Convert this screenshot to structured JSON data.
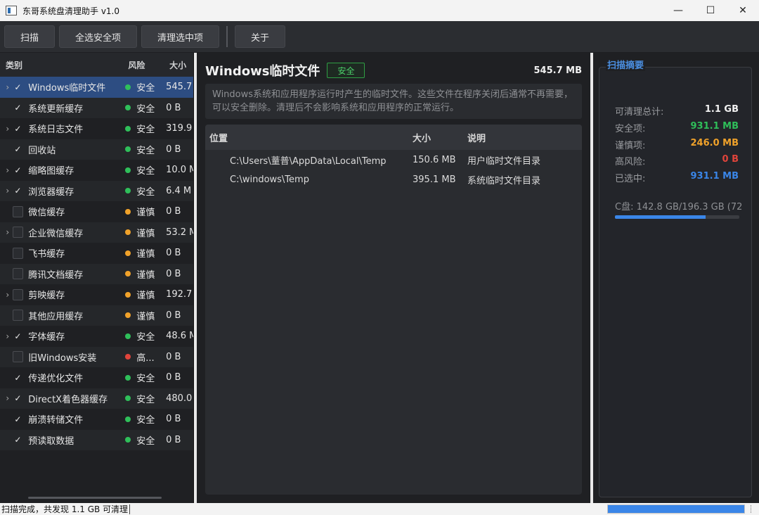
{
  "window": {
    "title": "东哥系统盘清理助手 v1.0",
    "minimize": "—",
    "maximize": "☐",
    "close": "✕"
  },
  "toolbar": {
    "scan": "扫描",
    "select_safe": "全选安全项",
    "clean_selected": "清理选中项",
    "about": "关于"
  },
  "list": {
    "headers": {
      "category": "类别",
      "risk": "风险",
      "size": "大小"
    },
    "items": [
      {
        "expand": "›",
        "checked": true,
        "name": "Windows临时文件",
        "risk": "安全",
        "size": "545.7",
        "level": "safe",
        "selected": true
      },
      {
        "expand": "",
        "checked": true,
        "name": "系统更新缓存",
        "risk": "安全",
        "size": "0 B",
        "level": "safe"
      },
      {
        "expand": "›",
        "checked": true,
        "name": "系统日志文件",
        "risk": "安全",
        "size": "319.9",
        "level": "safe"
      },
      {
        "expand": "",
        "checked": true,
        "name": "回收站",
        "risk": "安全",
        "size": "0 B",
        "level": "safe"
      },
      {
        "expand": "›",
        "checked": true,
        "name": "缩略图缓存",
        "risk": "安全",
        "size": "10.0 M",
        "level": "safe"
      },
      {
        "expand": "›",
        "checked": true,
        "name": "浏览器缓存",
        "risk": "安全",
        "size": "6.4 M",
        "level": "safe"
      },
      {
        "expand": "",
        "checked": false,
        "name": "微信缓存",
        "risk": "谨慎",
        "size": "0 B",
        "level": "caution"
      },
      {
        "expand": "›",
        "checked": false,
        "name": "企业微信缓存",
        "risk": "谨慎",
        "size": "53.2 M",
        "level": "caution"
      },
      {
        "expand": "",
        "checked": false,
        "name": "飞书缓存",
        "risk": "谨慎",
        "size": "0 B",
        "level": "caution"
      },
      {
        "expand": "",
        "checked": false,
        "name": "腾讯文档缓存",
        "risk": "谨慎",
        "size": "0 B",
        "level": "caution"
      },
      {
        "expand": "›",
        "checked": false,
        "name": "剪映缓存",
        "risk": "谨慎",
        "size": "192.7",
        "level": "caution"
      },
      {
        "expand": "",
        "checked": false,
        "name": "其他应用缓存",
        "risk": "谨慎",
        "size": "0 B",
        "level": "caution"
      },
      {
        "expand": "›",
        "checked": true,
        "name": "字体缓存",
        "risk": "安全",
        "size": "48.6 M",
        "level": "safe"
      },
      {
        "expand": "",
        "checked": false,
        "name": "旧Windows安装",
        "risk": "高...",
        "size": "0 B",
        "level": "high"
      },
      {
        "expand": "",
        "checked": true,
        "name": "传递优化文件",
        "risk": "安全",
        "size": "0 B",
        "level": "safe"
      },
      {
        "expand": "›",
        "checked": true,
        "name": "DirectX着色器缓存",
        "risk": "安全",
        "size": "480.0",
        "level": "safe"
      },
      {
        "expand": "",
        "checked": true,
        "name": "崩溃转储文件",
        "risk": "安全",
        "size": "0 B",
        "level": "safe"
      },
      {
        "expand": "",
        "checked": true,
        "name": "预读取数据",
        "risk": "安全",
        "size": "0 B",
        "level": "safe"
      }
    ]
  },
  "detail": {
    "title": "Windows临时文件",
    "badge": "安全",
    "size": "545.7 MB",
    "description": "Windows系统和应用程序运行时产生的临时文件。这些文件在程序关闭后通常不再需要，可以安全删除。清理后不会影响系统和应用程序的正常运行。",
    "table": {
      "headers": {
        "location": "位置",
        "size": "大小",
        "note": "说明"
      },
      "rows": [
        {
          "location": "C:\\Users\\蕫普\\AppData\\Local\\Temp",
          "size": "150.6 MB",
          "note": "用户临时文件目录"
        },
        {
          "location": "C:\\windows\\Temp",
          "size": "395.1 MB",
          "note": "系统临时文件目录"
        }
      ]
    }
  },
  "summary": {
    "title": "扫描摘要",
    "total_label": "可清理总计:",
    "total_value": "1.1 GB",
    "safe_label": "安全项:",
    "safe_value": "931.1 MB",
    "caution_label": "谨慎项:",
    "caution_value": "246.0 MB",
    "high_label": "高风险:",
    "high_value": "0 B",
    "selected_label": "已选中:",
    "selected_value": "931.1 MB",
    "disk": "C盘: 142.8 GB/196.3 GB (72",
    "disk_usage_fraction": 0.727
  },
  "status": {
    "text": "扫描完成，共发现 1.1 GB 可清理",
    "progress_fraction": 1.0
  },
  "colors": {
    "safe": "#2fbf5a",
    "caution": "#f0a22a",
    "high": "#e0443b",
    "accent": "#3a86e8",
    "white": "#f1f1f1"
  }
}
